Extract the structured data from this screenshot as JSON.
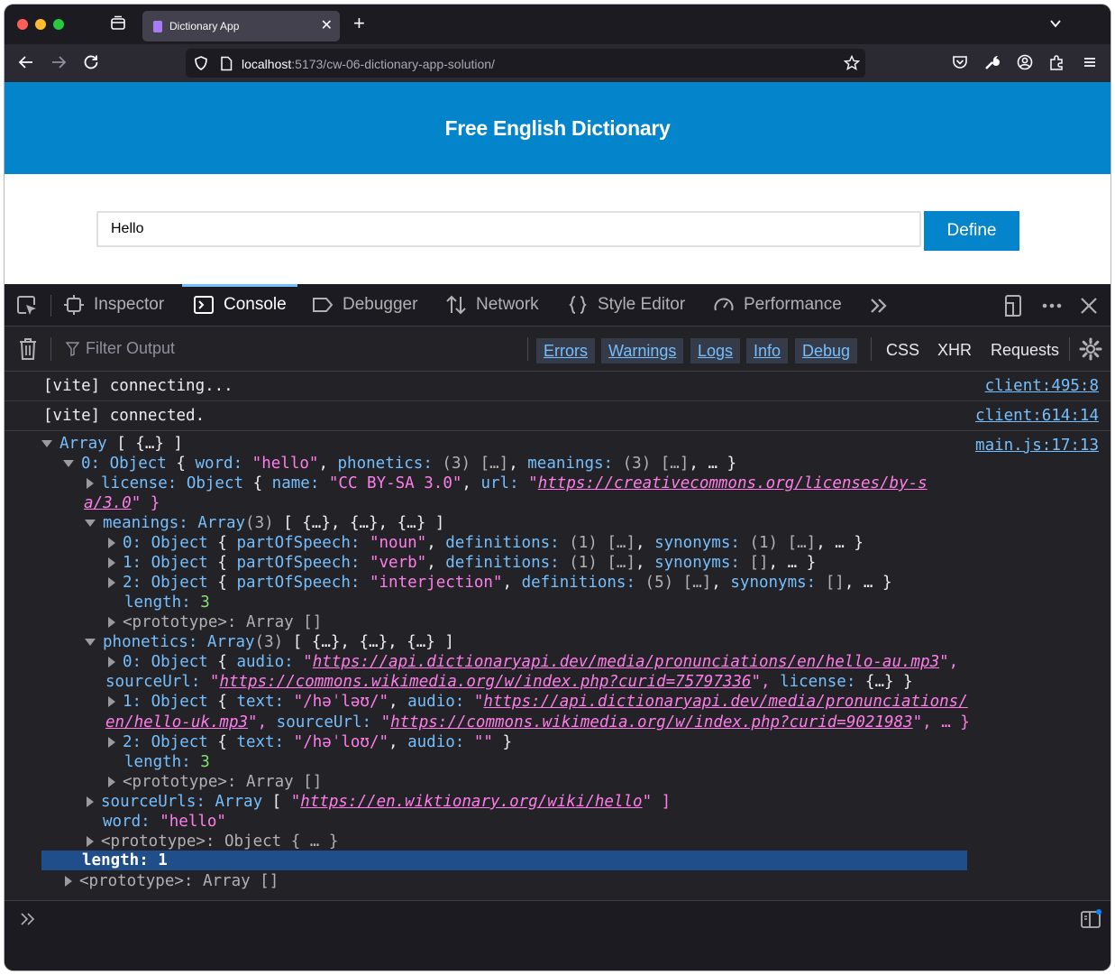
{
  "browser": {
    "tab_title": "Dictionary App",
    "tab_close": "✕",
    "new_tab": "+",
    "url_host": "localhost",
    "url_path": ":5173/cw-06-dictionary-app-solution/"
  },
  "page": {
    "title": "Free English Dictionary",
    "search_value": "Hello",
    "define_label": "Define"
  },
  "devtools": {
    "tabs": [
      "Inspector",
      "Console",
      "Debugger",
      "Network",
      "Style Editor",
      "Performance"
    ],
    "active_tab": "Console",
    "filter_placeholder": "Filter Output",
    "levels": [
      "Errors",
      "Warnings",
      "Logs",
      "Info",
      "Debug"
    ],
    "extra_filters": [
      "CSS",
      "XHR",
      "Requests"
    ]
  },
  "console": {
    "messages": [
      {
        "text": "[vite] connecting...",
        "source": "client:495:8"
      },
      {
        "text": "[vite] connected.",
        "source": "client:614:14"
      }
    ],
    "array_source": "main.js:17:13",
    "lines": {
      "l1_a": "Array ",
      "l1_b": "[ {…} ]",
      "l2_key": "0: ",
      "l2_type": "Object ",
      "l2_b": "{ ",
      "l2_c": "word: ",
      "l2_d": "\"hello\"",
      "l2_e": ", ",
      "l2_f": "phonetics: ",
      "l2_g": "(3) […]",
      "l2_h": ", ",
      "l2_i": "meanings: ",
      "l2_j": "(3) […]",
      "l2_k": ", … }",
      "l3_a": "license: ",
      "l3_b": "Object ",
      "l3_c": "{ ",
      "l3_d": "name: ",
      "l3_e": "\"CC BY-SA 3.0\"",
      "l3_f": ", ",
      "l3_g": "url: ",
      "l3_h": "\"",
      "l3_i": "https://creativecommons.org/licenses/by-s",
      "l4_a": "a/3.0",
      "l4_b": "\" }",
      "l5_a": "meanings: ",
      "l5_b": "Array",
      "l5_c": "(3) ",
      "l5_d": "[ {…}, {…}, {…} ]",
      "l6_a": "0: ",
      "l6_b": "Object ",
      "l6_c": "{ ",
      "l6_d": "partOfSpeech: ",
      "l6_e": "\"noun\"",
      "l6_f": ", ",
      "l6_g": "definitions: ",
      "l6_h": "(1) […]",
      "l6_i": ", ",
      "l6_j": "synonyms: ",
      "l6_k": "(1) […]",
      "l6_l": ", … }",
      "l7_a": "1: ",
      "l7_b": "Object ",
      "l7_c": "{ ",
      "l7_d": "partOfSpeech: ",
      "l7_e": "\"verb\"",
      "l7_f": ", ",
      "l7_g": "definitions: ",
      "l7_h": "(1) […]",
      "l7_i": ", ",
      "l7_j": "synonyms: ",
      "l7_k": "[]",
      "l7_l": ", … }",
      "l8_a": "2: ",
      "l8_b": "Object ",
      "l8_c": "{ ",
      "l8_d": "partOfSpeech: ",
      "l8_e": "\"interjection\"",
      "l8_f": ", ",
      "l8_g": "definitions: ",
      "l8_h": "(5) […]",
      "l8_i": ", ",
      "l8_j": "synonyms: ",
      "l8_k": "[]",
      "l8_l": ", … }",
      "l9_a": "length: ",
      "l9_b": "3",
      "l10_a": "<prototype>: ",
      "l10_b": "Array []",
      "l11_a": "phonetics: ",
      "l11_b": "Array",
      "l11_c": "(3) ",
      "l11_d": "[ {…}, {…}, {…} ]",
      "l12_a": "0: ",
      "l12_b": "Object ",
      "l12_c": "{ ",
      "l12_d": "audio: ",
      "l12_e": "\"",
      "l12_f": "https://api.dictionaryapi.dev/media/pronunciations/en/hello-au.mp3",
      "l12_g": "\",",
      "l13_a": "sourceUrl: ",
      "l13_b": "\"",
      "l13_c": "https://commons.wikimedia.org/w/index.php?curid=75797336",
      "l13_d": "\", ",
      "l13_e": "license: ",
      "l13_f": "{…} }",
      "l14_a": "1: ",
      "l14_b": "Object ",
      "l14_c": "{ ",
      "l14_d": "text: ",
      "l14_e": "\"/həˈləʊ/\"",
      "l14_f": ", ",
      "l14_g": "audio: ",
      "l14_h": "\"",
      "l14_i": "https://api.dictionaryapi.dev/media/pronunciations/",
      "l15_a": "en/hello-uk.mp3",
      "l15_b": "\", ",
      "l15_c": "sourceUrl: ",
      "l15_d": "\"",
      "l15_e": "https://commons.wikimedia.org/w/index.php?curid=9021983",
      "l15_f": "\", … }",
      "l16_a": "2: ",
      "l16_b": "Object ",
      "l16_c": "{ ",
      "l16_d": "text: ",
      "l16_e": "\"/həˈloʊ/\"",
      "l16_f": ", ",
      "l16_g": "audio: ",
      "l16_h": "\"\"",
      "l16_i": " }",
      "l17_a": "length: ",
      "l17_b": "3",
      "l18_a": "<prototype>: ",
      "l18_b": "Array []",
      "l19_a": "sourceUrls: ",
      "l19_b": "Array ",
      "l19_c": "[ ",
      "l19_d": "\"",
      "l19_e": "https://en.wiktionary.org/wiki/hello",
      "l19_f": "\" ]",
      "l20_a": "word: ",
      "l20_b": "\"hello\"",
      "l21_a": "<prototype>: ",
      "l21_b": "Object { … }",
      "l22_a": "length: ",
      "l22_b": "1",
      "l23_a": "<prototype>: ",
      "l23_b": "Array []"
    }
  },
  "colors": {
    "banner": "#0484ca",
    "console_key": "#75bfff",
    "console_string": "#ff7de9",
    "console_number": "#86de74",
    "selection": "#204e8a"
  },
  "icons": [
    "tab-overview-icon",
    "back-icon",
    "forward-icon",
    "reload-icon",
    "shield-icon",
    "page-icon",
    "bookmark-star-icon",
    "pocket-icon",
    "wrench-icon",
    "account-icon",
    "extensions-icon",
    "menu-icon",
    "element-picker-icon",
    "trash-icon",
    "filter-icon",
    "settings-gear-icon",
    "console-prompt-icon",
    "sidebar-toggle-icon"
  ]
}
